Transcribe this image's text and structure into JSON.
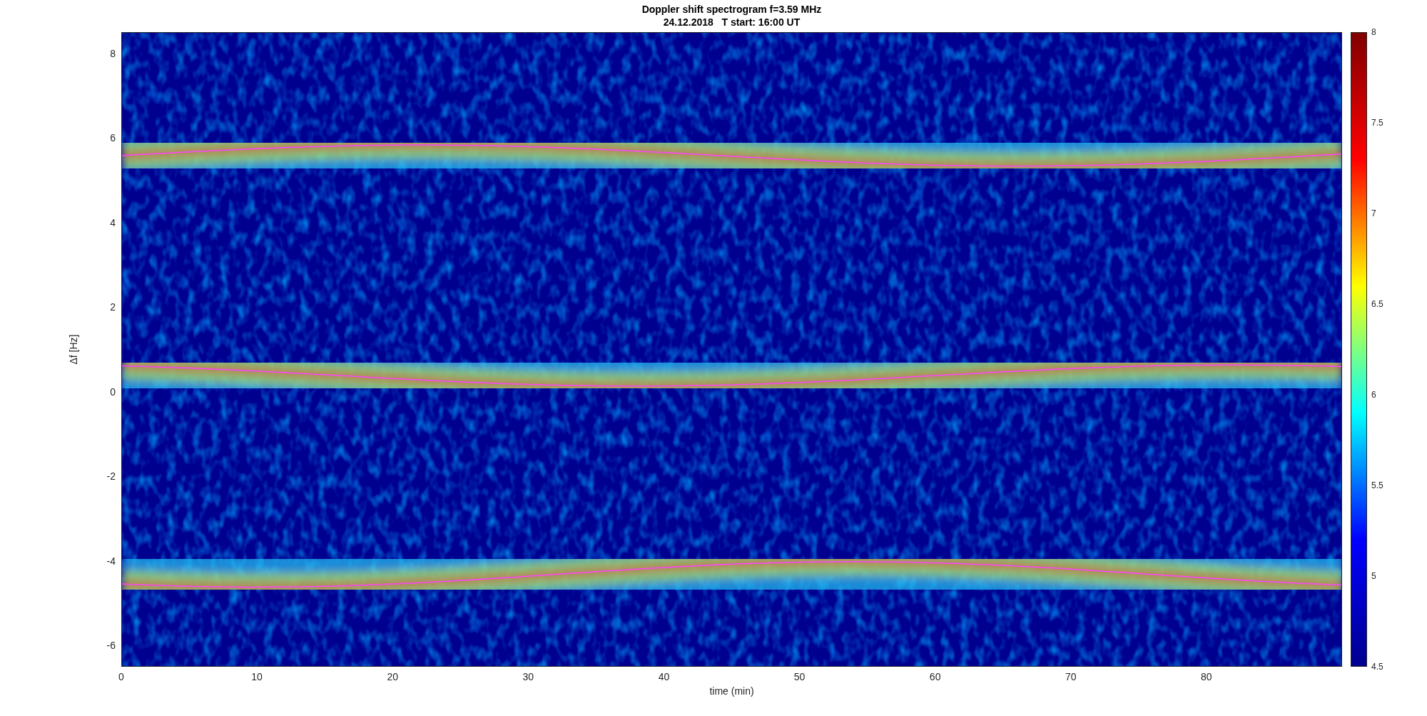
{
  "title": "Doppler shift spectrogram f=3.59 MHz",
  "subtitle": "24.12.2018   T start: 16:00 UT",
  "xlabel": "time (min)",
  "ylabel": "Δf [Hz]",
  "xticks": [
    "0",
    "10",
    "20",
    "30",
    "40",
    "50",
    "60",
    "70",
    "80"
  ],
  "yticks": [
    "8",
    "6",
    "4",
    "2",
    "0",
    "-2",
    "-4",
    "-6"
  ],
  "colorbar": {
    "ticks": [
      "8",
      "7.5",
      "7",
      "6.5",
      "6",
      "5.5",
      "5",
      "4.5"
    ]
  }
}
